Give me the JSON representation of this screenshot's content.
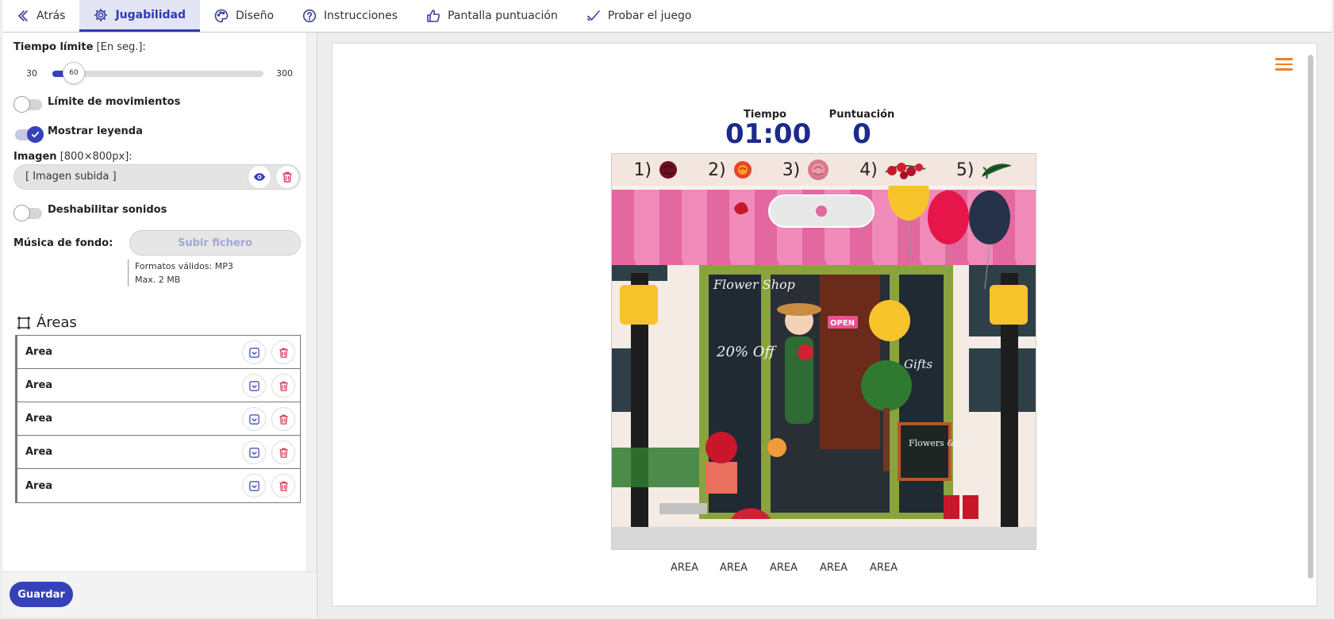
{
  "tabs": [
    {
      "label": "Atrás",
      "icon": "chevron-left-icon"
    },
    {
      "label": "Jugabilidad",
      "icon": "gear-icon",
      "active": true
    },
    {
      "label": "Diseño",
      "icon": "palette-icon"
    },
    {
      "label": "Instrucciones",
      "icon": "question-circle-icon"
    },
    {
      "label": "Pantalla puntuación",
      "icon": "thumbs-up-icon"
    },
    {
      "label": "Probar el juego",
      "icon": "check-icon"
    }
  ],
  "settings": {
    "time_limit_label": "Tiempo límite",
    "time_limit_hint": "[En seg.]:",
    "slider_min": "30",
    "slider_max": "300",
    "slider_value": "60",
    "move_limit_label": "Límite de movimientos",
    "show_legend_label": "Mostrar leyenda",
    "image_label": "Imagen",
    "image_hint": "[800×800px]:",
    "image_value": "[ Imagen subida ]",
    "disable_sounds_label": "Deshabilitar sonidos",
    "music_label": "Música de fondo:",
    "upload_label": "Subir fichero",
    "formats_hint": "Formatos válidos: MP3",
    "max_size_hint": "Max. 2 MB"
  },
  "areas": {
    "title": "Áreas",
    "items": [
      "Area",
      "Area",
      "Area",
      "Area",
      "Area"
    ]
  },
  "save_label": "Guardar",
  "preview": {
    "time_label": "Tiempo",
    "time_value": "01:00",
    "score_label": "Puntuación",
    "score_value": "0",
    "legend": [
      "1)",
      "2)",
      "3)",
      "4)",
      "5)"
    ],
    "sign_flower_shop": "Flower Shop",
    "sign_discount": "20% Off",
    "sign_gifts": "Gifts",
    "sign_open": "OPEN",
    "sign_board": "Flowers & Gifts",
    "area_labels": [
      "AREA",
      "AREA",
      "AREA",
      "AREA",
      "AREA"
    ]
  },
  "colors": {
    "accent": "#3541b8",
    "score_text": "#1c2a8c",
    "menu_icon": "#ef7f2a",
    "delete_icon": "#d0405a"
  }
}
